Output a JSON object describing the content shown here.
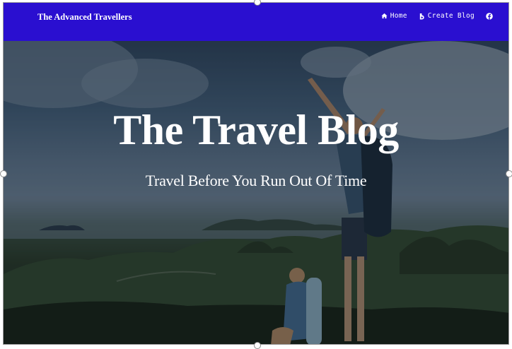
{
  "navbar": {
    "brand": "The Advanced Travellers",
    "background": "#2a0fd0",
    "items": [
      {
        "label": "Home",
        "icon": "home-icon"
      },
      {
        "label": "Create Blog",
        "icon": "blog-icon"
      },
      {
        "label": "",
        "icon": "facebook-icon"
      }
    ]
  },
  "hero": {
    "title": "The Travel Blog",
    "subtitle": "Travel Before You Run Out Of Time",
    "image": "two-hikers-on-mountain-summit-photo"
  }
}
